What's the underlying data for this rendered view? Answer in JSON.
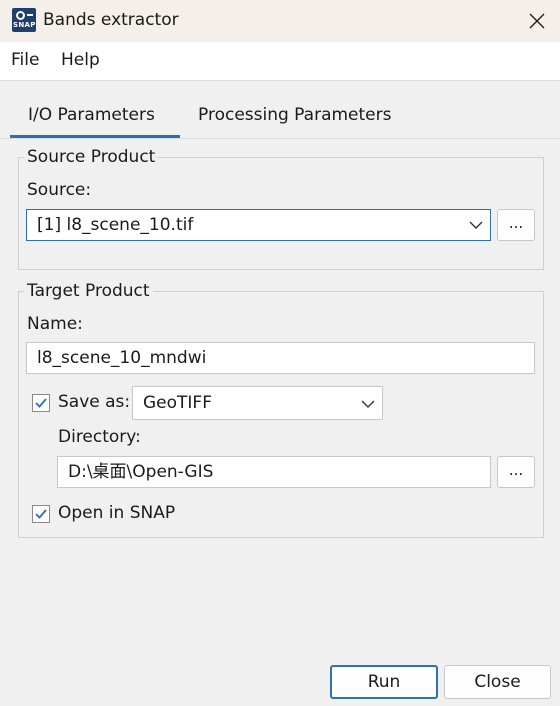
{
  "window": {
    "title": "Bands extractor",
    "icon_text": "SNAP",
    "close_icon": "close-icon"
  },
  "menu": {
    "items": [
      "File",
      "Help"
    ]
  },
  "tabs": [
    {
      "label": "I/O Parameters",
      "active": true
    },
    {
      "label": "Processing Parameters",
      "active": false
    }
  ],
  "source_product": {
    "legend": "Source Product",
    "source_label": "Source:",
    "source_value": "[1] l8_scene_10.tif",
    "browse_label": "..."
  },
  "target_product": {
    "legend": "Target Product",
    "name_label": "Name:",
    "name_value": "l8_scene_10_mndwi",
    "save_as_label": "Save as:",
    "save_as_checked": true,
    "format_value": "GeoTIFF",
    "directory_label": "Directory:",
    "directory_value": "D:\\桌面\\Open-GIS",
    "browse_label": "...",
    "open_in_snap_label": "Open in SNAP",
    "open_in_snap_checked": true
  },
  "buttons": {
    "run": "Run",
    "close": "Close"
  },
  "colors": {
    "accent": "#2f6fb3",
    "titlebar": "#f5efe9",
    "background": "#f0f0f0"
  }
}
